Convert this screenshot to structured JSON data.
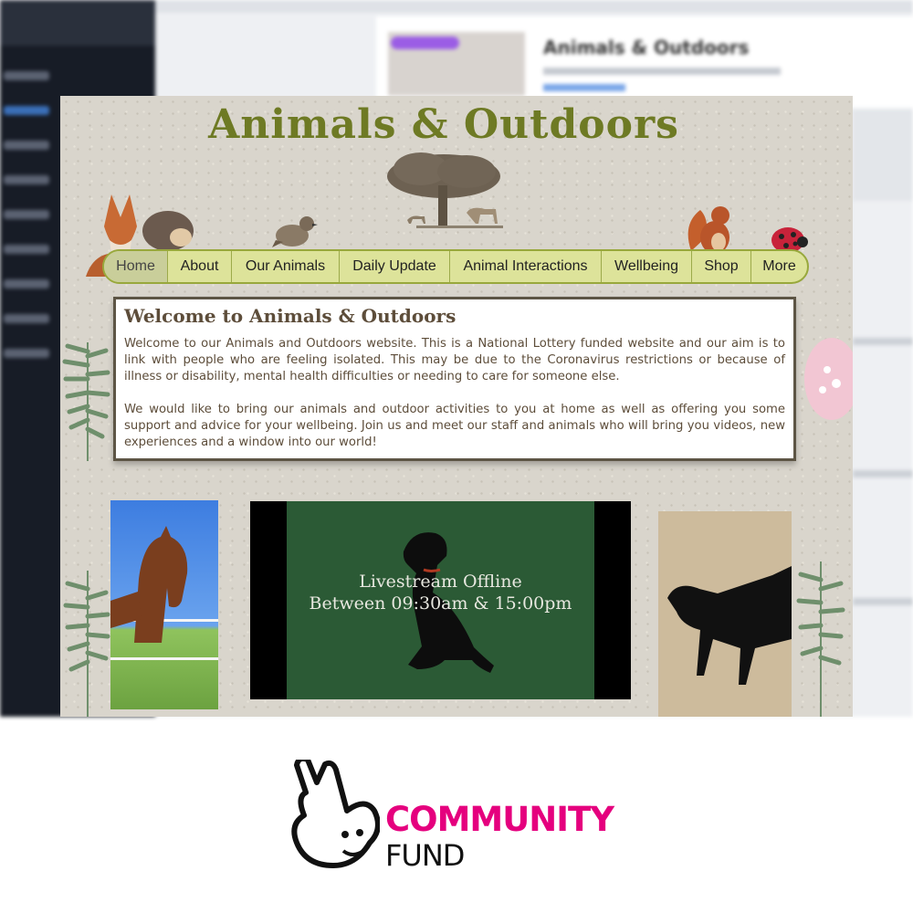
{
  "background_page": {
    "card_title": "Animals & Outdoors"
  },
  "site": {
    "title": "Animals & Outdoors",
    "nav": [
      {
        "label": "Home",
        "active": true
      },
      {
        "label": "About"
      },
      {
        "label": "Our Animals"
      },
      {
        "label": "Daily Update"
      },
      {
        "label": "Animal Interactions"
      },
      {
        "label": "Wellbeing"
      },
      {
        "label": "Shop"
      },
      {
        "label": "More"
      }
    ],
    "welcome": {
      "heading": "Welcome to Animals & Outdoors",
      "para1": "Welcome to our Animals and Outdoors website. This is a National Lottery funded website and our aim is to link with people who are feeling isolated. This may be due to the Coronavirus restrictions or because of illness or disability, mental health difficulties or needing to care for someone else.",
      "para2": "We would like to bring our animals and outdoor activities to you at home as well as offering you some support and advice for your wellbeing. Join us and meet our staff and animals who will bring you videos, new experiences and a window into our world!"
    },
    "video": {
      "line1": "Livestream Offline",
      "line2": "Between 09:30am & 15:00pm"
    }
  },
  "logo": {
    "line1": "COMMUNITY",
    "line2": "FUND",
    "brand_color": "#e5007e"
  },
  "colors": {
    "title_green": "#6e7a24",
    "nav_bg": "#dde39a",
    "video_green": "#2b5a35"
  }
}
